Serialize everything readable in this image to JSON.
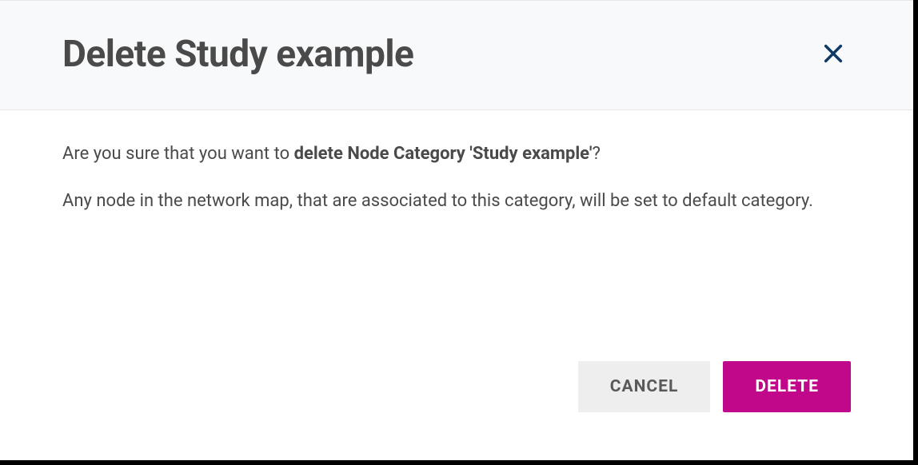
{
  "dialog": {
    "title": "Delete Study example",
    "confirm_prefix": "Are you sure that you want to ",
    "confirm_bold": "delete Node Category 'Study example'",
    "confirm_suffix": "?",
    "info_text": "Any node in the network map, that are associated to this category, will be set to default category.",
    "cancel_label": "CANCEL",
    "delete_label": "DELETE"
  }
}
